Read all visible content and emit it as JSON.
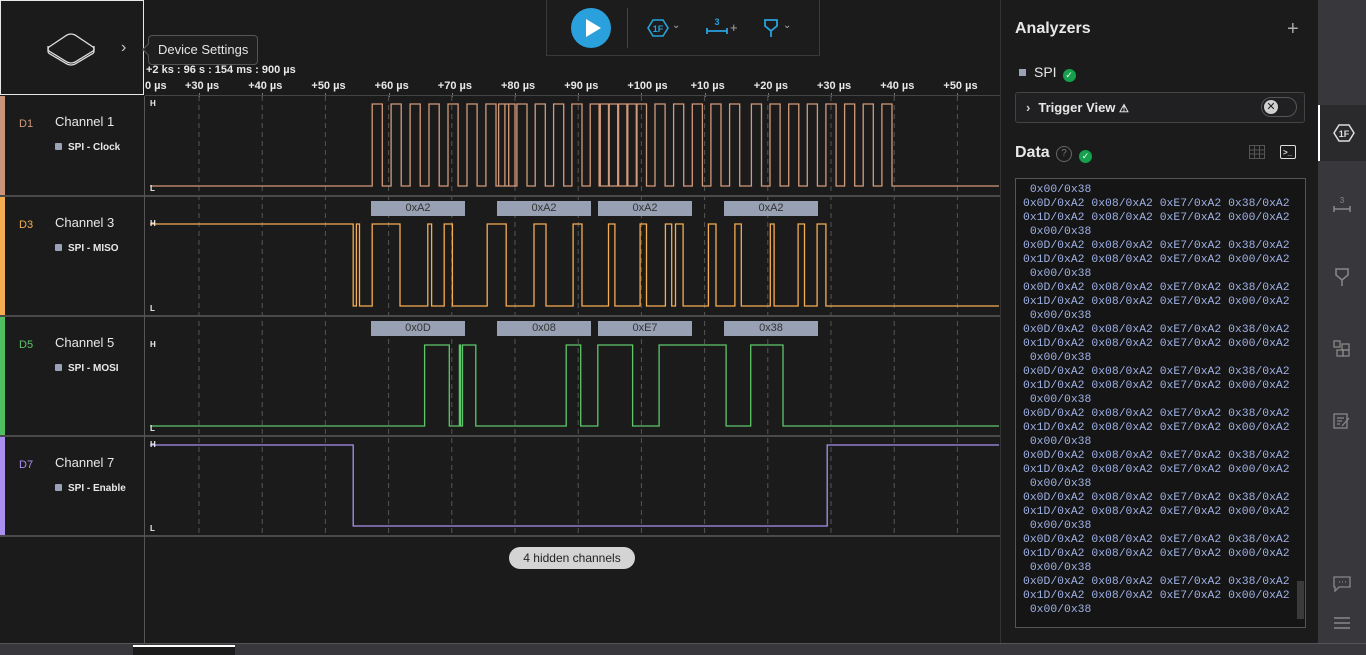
{
  "device": {
    "tooltip": "Device Settings",
    "chevron": "›"
  },
  "timestamp": "+2 ks : 96 s : 154 ms : 900 µs",
  "toolbar": {
    "play_icon": "play-icon",
    "analyzer_icon_text": "1F",
    "measure_icon_text": "3",
    "measure_plus": "+",
    "chev": "⌄"
  },
  "ruler": {
    "ticks": [
      {
        "t": 22,
        "label": "0 µs"
      },
      {
        "t": 30,
        "label": "+30 µs"
      },
      {
        "t": 40,
        "label": "+40 µs"
      },
      {
        "t": 50,
        "label": "+50 µs"
      },
      {
        "t": 60,
        "label": "+60 µs"
      },
      {
        "t": 70,
        "label": "+70 µs"
      },
      {
        "t": 80,
        "label": "+80 µs"
      },
      {
        "t": 90,
        "label": "+90 µs"
      },
      {
        "t": 100,
        "label": "+100 µs"
      },
      {
        "t": 110,
        "label": "+10 µs"
      },
      {
        "t": 120,
        "label": "+20 µs"
      },
      {
        "t": 130,
        "label": "+30 µs"
      },
      {
        "t": 140,
        "label": "+40 µs"
      },
      {
        "t": 150,
        "label": "+50 µs"
      }
    ]
  },
  "channels": [
    {
      "id": "D1",
      "name": "Channel 1",
      "analyzer": "SPI - Clock",
      "color": "#d39a7a",
      "bar": "#c99479",
      "initial": 0,
      "edges": [
        57.4,
        60.2,
        61.2,
        64.0,
        65.2,
        68.0,
        69.2,
        72.0,
        73.2,
        76.0,
        77.2,
        80.0,
        81.2,
        84.0,
        85.0,
        87.8,
        92.3,
        95.0,
        96.2,
        99.0,
        100.2,
        103.0,
        104.2,
        107.0,
        108.2,
        111.0,
        112.2,
        115.0,
        116.2,
        119.0,
        120.0,
        122.8,
        119.5,
        126.8,
        127.8,
        130.6,
        131.6,
        134.4,
        135.4,
        138.2,
        139.4,
        142.2,
        143.4,
        146.2,
        147.4,
        150.2,
        151.2,
        154.0,
        172.4,
        175.2,
        176.4,
        179.2,
        180.4,
        183.2,
        184.4,
        187.2,
        188.4,
        191.2,
        192.4,
        195.2,
        196.4,
        199.2,
        200.2,
        203.0
      ]
    },
    {
      "id": "D3",
      "name": "Channel 3",
      "analyzer": "SPI - MISO",
      "color": "#f5ad52",
      "bar": "#f5ad52",
      "initial": 1,
      "edges": [],
      "decodes": [
        "0xA2",
        "0xA2",
        "0xA2",
        "0xA2"
      ]
    },
    {
      "id": "D5",
      "name": "Channel 5",
      "analyzer": "SPI - MOSI",
      "color": "#5dc76a",
      "bar": "#4fbf62",
      "initial": 0,
      "edges": [],
      "decodes": [
        "0x0D",
        "0x08",
        "0xE7",
        "0x38"
      ]
    },
    {
      "id": "D7",
      "name": "Channel 7",
      "analyzer": "SPI - Enable",
      "color": "#a98ff0",
      "bar": "#a98ff0",
      "initial": 1,
      "edges": []
    }
  ],
  "hidden_channels": "4 hidden channels",
  "analyzers": {
    "title": "Analyzers",
    "add": "+",
    "items": [
      {
        "name": "SPI",
        "status": "ok"
      }
    ],
    "trigger_view": {
      "label": "Trigger View",
      "warning": "⚠",
      "chevron": "›",
      "toggle_on": false
    }
  },
  "data_panel": {
    "title": "Data",
    "help": "?",
    "terminal_lines": [
      " 0x00/0x38",
      "0x0D/0xA2 0x08/0xA2 0xE7/0xA2 0x38/0xA2",
      "0x1D/0xA2 0x08/0xA2 0xE7/0xA2 0x00/0xA2",
      " 0x00/0x38",
      "0x0D/0xA2 0x08/0xA2 0xE7/0xA2 0x38/0xA2",
      "0x1D/0xA2 0x08/0xA2 0xE7/0xA2 0x00/0xA2",
      " 0x00/0x38",
      "0x0D/0xA2 0x08/0xA2 0xE7/0xA2 0x38/0xA2",
      "0x1D/0xA2 0x08/0xA2 0xE7/0xA2 0x00/0xA2",
      " 0x00/0x38",
      "0x0D/0xA2 0x08/0xA2 0xE7/0xA2 0x38/0xA2",
      "0x1D/0xA2 0x08/0xA2 0xE7/0xA2 0x00/0xA2",
      " 0x00/0x38",
      "0x0D/0xA2 0x08/0xA2 0xE7/0xA2 0x38/0xA2",
      "0x1D/0xA2 0x08/0xA2 0xE7/0xA2 0x00/0xA2",
      " 0x00/0x38",
      "0x0D/0xA2 0x08/0xA2 0xE7/0xA2 0x38/0xA2",
      "0x1D/0xA2 0x08/0xA2 0xE7/0xA2 0x00/0xA2",
      " 0x00/0x38",
      "0x0D/0xA2 0x08/0xA2 0xE7/0xA2 0x38/0xA2",
      "0x1D/0xA2 0x08/0xA2 0xE7/0xA2 0x00/0xA2",
      " 0x00/0x38",
      "0x0D/0xA2 0x08/0xA2 0xE7/0xA2 0x38/0xA2",
      "0x1D/0xA2 0x08/0xA2 0xE7/0xA2 0x00/0xA2",
      " 0x00/0x38",
      "0x0D/0xA2 0x08/0xA2 0xE7/0xA2 0x38/0xA2",
      "0x1D/0xA2 0x08/0xA2 0xE7/0xA2 0x00/0xA2",
      " 0x00/0x38",
      "0x0D/0xA2 0x08/0xA2 0xE7/0xA2 0x38/0xA2",
      "0x1D/0xA2 0x08/0xA2 0xE7/0xA2 0x00/0xA2",
      " 0x00/0x38"
    ]
  },
  "rail": {
    "items": [
      {
        "name": "analyzers",
        "glyph": "1F",
        "active": true
      },
      {
        "name": "timing-markers",
        "glyph": "3",
        "active": false
      },
      {
        "name": "triggers",
        "glyph": "▽",
        "active": false
      },
      {
        "name": "extensions",
        "glyph": "⧉",
        "active": false
      },
      {
        "name": "notes",
        "glyph": "✎",
        "active": false
      }
    ],
    "bottom": [
      {
        "name": "feedback",
        "glyph": "…"
      },
      {
        "name": "menu",
        "glyph": "≡"
      }
    ]
  }
}
